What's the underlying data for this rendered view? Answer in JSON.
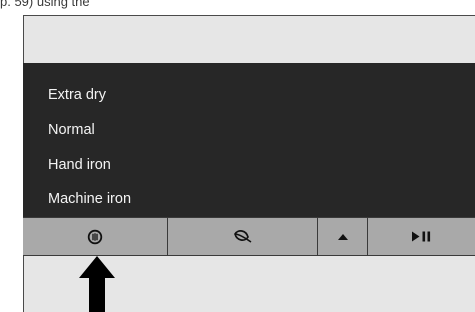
{
  "caption": {
    "text": "p. 59) using the"
  },
  "menu": {
    "items": [
      {
        "label": "Extra dry"
      },
      {
        "label": "Normal"
      },
      {
        "label": "Hand iron"
      },
      {
        "label": "Machine iron"
      }
    ]
  },
  "buttons": [
    {
      "icon": "drying-level-icon"
    },
    {
      "icon": "leaf-eco-icon"
    },
    {
      "icon": "triangle-up-icon"
    },
    {
      "icon": "play-pause-icon",
      "glyph": "▶II"
    }
  ],
  "colors": {
    "menu_background": "#272727",
    "menu_text": "#f4f4f4",
    "button_bar": "#a9a9a9",
    "panel": "#e6e6e6",
    "arrow": "#000000"
  }
}
